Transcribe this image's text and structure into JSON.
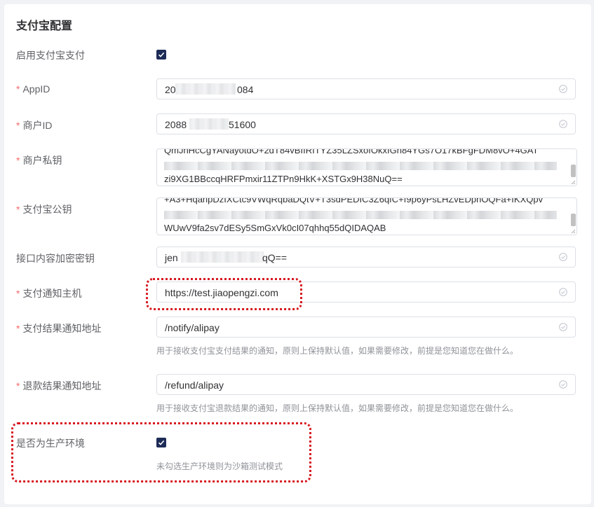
{
  "card_title": "支付宝配置",
  "fields": {
    "enable_alipay": {
      "label": "启用支付宝支付",
      "checked": true
    },
    "app_id": {
      "label": "AppID",
      "required": "*",
      "value_start": "20",
      "value_end": "084"
    },
    "merchant_id": {
      "label": "商户ID",
      "required": "*",
      "value_start": "2088",
      "value_end": "51600"
    },
    "merchant_private_key": {
      "label": "商户私钥",
      "required": "*",
      "line_top": "QmJhHcCgYANayotdO+2dT84vBIIRITYZ35LZSxofOkxIGn84YGs7O17kBFgFDM8vO+4GAT",
      "line_bottom": "zi9XG1BBccqHRFPmxir11ZTPn9HkK+XSTGx9H38NuQ=="
    },
    "alipay_public_key": {
      "label": "支付宝公钥",
      "required": "*",
      "line_top": "+A3+HqanpDzIXCtc9VWqRqbaDQtV+T3sdPEDIC3Z6qfC+f9p6yPsLHZvEDpnOQFa+IKXQpv",
      "line_bottom": "WUwV9fa2sv7dESy5SmGxVk0cI07qhhq55dQIDAQAB"
    },
    "content_encrypt_key": {
      "label": "接口内容加密密钥",
      "value_start": "jen",
      "value_end": "qQ=="
    },
    "notify_host": {
      "label": "支付通知主机",
      "required": "*",
      "value": "https://test.jiaopengzi.com"
    },
    "pay_notify_url": {
      "label": "支付结果通知地址",
      "required": "*",
      "value": "/notify/alipay",
      "hint": "用于接收支付宝支付结果的通知，原则上保持默认值，如果需要修改，前提是您知道您在做什么。"
    },
    "refund_notify_url": {
      "label": "退款结果通知地址",
      "required": "*",
      "value": "/refund/alipay",
      "hint": "用于接收支付宝退款结果的通知，原则上保持默认值，如果需要修改，前提是您知道您在做什么。"
    },
    "is_production": {
      "label": "是否为生产环境",
      "checked": true,
      "hint": "未勾选生产环境则为沙箱测试模式"
    }
  },
  "colors": {
    "checkbox": "#1d2b57",
    "required": "#f56c6c",
    "highlight": "#d71920"
  },
  "icons": {
    "input_suffix": "circle-check-icon",
    "checkbox": "checkmark-icon"
  }
}
